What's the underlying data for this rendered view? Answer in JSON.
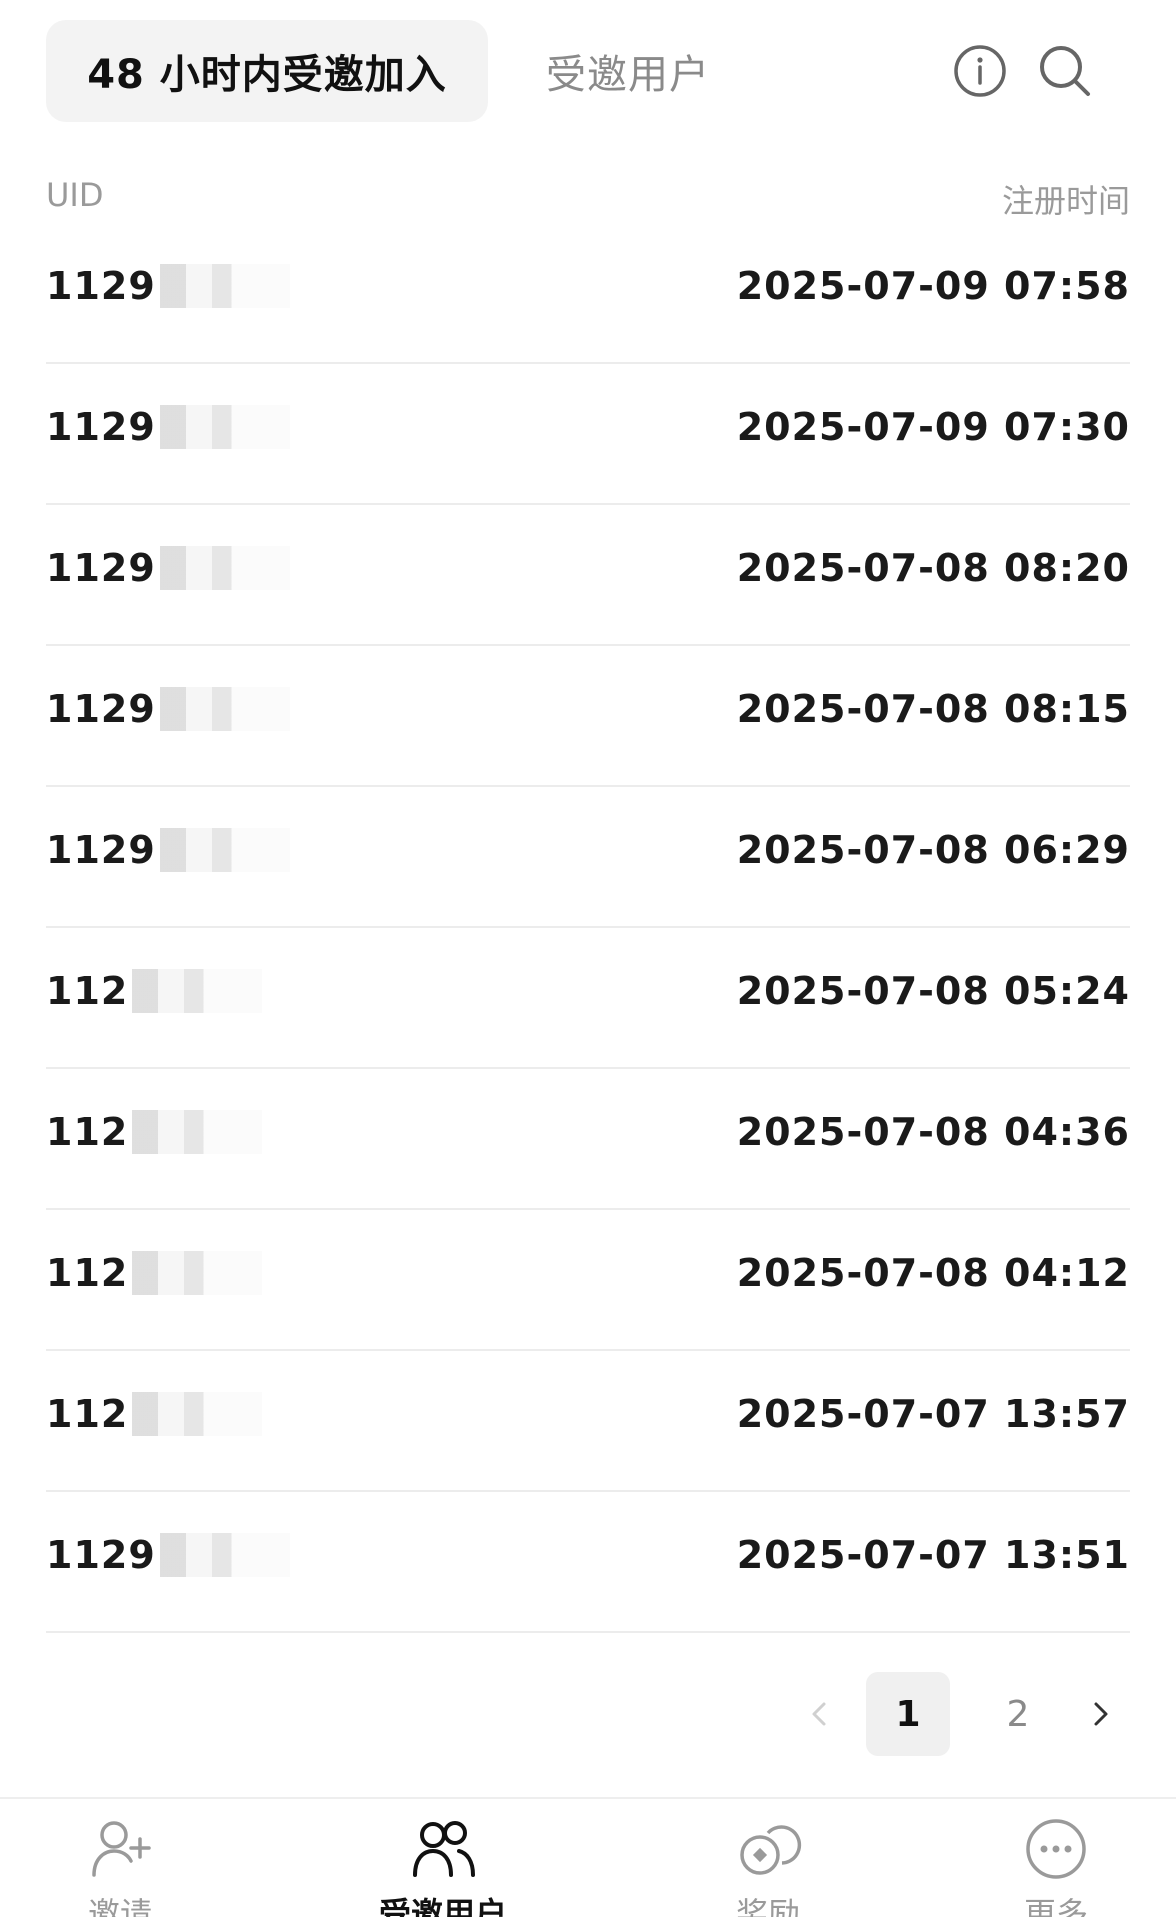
{
  "header": {
    "tab_active": "48 小时内受邀加入",
    "tab_inactive": "受邀用户"
  },
  "columns": {
    "uid": "UID",
    "time": "注册时间"
  },
  "rows": [
    {
      "uid": "1129",
      "time": "2025-07-09 07:58"
    },
    {
      "uid": "1129",
      "time": "2025-07-09 07:30"
    },
    {
      "uid": "1129",
      "time": "2025-07-08 08:20"
    },
    {
      "uid": "1129",
      "time": "2025-07-08 08:15"
    },
    {
      "uid": "1129",
      "time": "2025-07-08 06:29"
    },
    {
      "uid": "112",
      "time": "2025-07-08 05:24"
    },
    {
      "uid": "112",
      "time": "2025-07-08 04:36"
    },
    {
      "uid": "112",
      "time": "2025-07-08 04:12"
    },
    {
      "uid": "112",
      "time": "2025-07-07 13:57"
    },
    {
      "uid": "1129",
      "time": "2025-07-07 13:51"
    }
  ],
  "pagination": {
    "page_1": "1",
    "page_2": "2",
    "current": 1
  },
  "nav": [
    {
      "label": "邀请",
      "icon": "add-user-icon"
    },
    {
      "label": "受邀用户",
      "icon": "users-icon"
    },
    {
      "label": "奖励",
      "icon": "rewards-icon"
    },
    {
      "label": "更多",
      "icon": "more-icon"
    }
  ],
  "icons": {
    "info": "info-icon",
    "search": "search-icon",
    "prev": "chevron-left-icon",
    "next": "chevron-right-icon"
  }
}
